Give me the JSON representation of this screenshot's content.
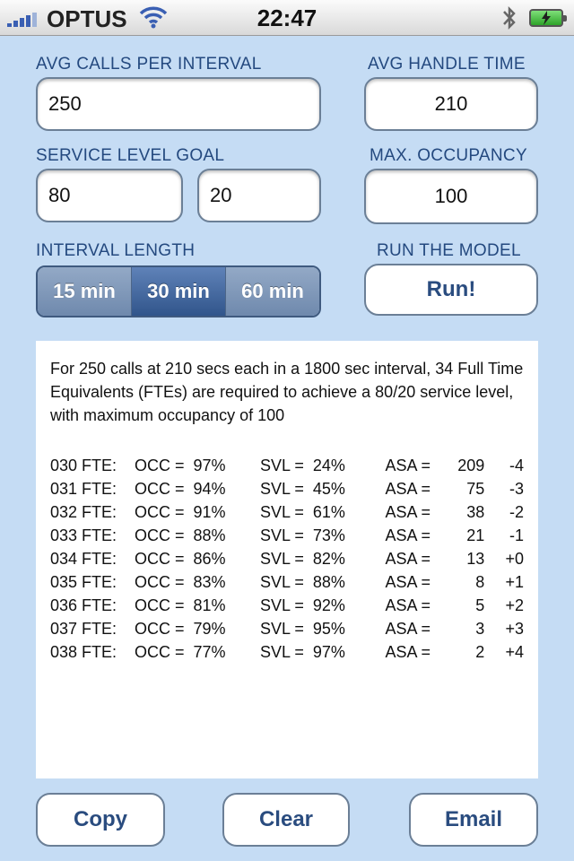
{
  "status_bar": {
    "carrier": "OPTUS",
    "time": "22:47"
  },
  "form": {
    "avg_calls_label": "AVG CALLS PER INTERVAL",
    "avg_calls_value": "250",
    "avg_handle_label": "AVG HANDLE TIME",
    "avg_handle_value": "210",
    "service_level_label": "SERVICE LEVEL GOAL",
    "service_level_percent": "80",
    "service_level_seconds": "20",
    "max_occupancy_label": "MAX. OCCUPANCY",
    "max_occupancy_value": "100",
    "interval_label": "INTERVAL LENGTH",
    "interval_options": [
      "15 min",
      "30 min",
      "60 min"
    ],
    "interval_selected": "30 min",
    "run_label": "RUN THE MODEL",
    "run_button": "Run!"
  },
  "results": {
    "summary": "For 250 calls at 210 secs each in a 1800 sec interval, 34 Full Time Equivalents (FTEs) are required to achieve a 80/20 service level, with maximum occupancy of 100",
    "rows": [
      {
        "fte": "030 FTE:",
        "occ": "OCC =  97%",
        "svl": "SVL =  24%",
        "asa": "ASA =",
        "asa_value": "209",
        "delta": "-4"
      },
      {
        "fte": "031 FTE:",
        "occ": "OCC =  94%",
        "svl": "SVL =  45%",
        "asa": "ASA =",
        "asa_value": "75",
        "delta": "-3"
      },
      {
        "fte": "032 FTE:",
        "occ": "OCC =  91%",
        "svl": "SVL =  61%",
        "asa": "ASA =",
        "asa_value": "38",
        "delta": "-2"
      },
      {
        "fte": "033 FTE:",
        "occ": "OCC =  88%",
        "svl": "SVL =  73%",
        "asa": "ASA =",
        "asa_value": "21",
        "delta": "-1"
      },
      {
        "fte": "034 FTE:",
        "occ": "OCC =  86%",
        "svl": "SVL =  82%",
        "asa": "ASA =",
        "asa_value": "13",
        "delta": "+0"
      },
      {
        "fte": "035 FTE:",
        "occ": "OCC =  83%",
        "svl": "SVL =  88%",
        "asa": "ASA =",
        "asa_value": "8",
        "delta": "+1"
      },
      {
        "fte": "036 FTE:",
        "occ": "OCC =  81%",
        "svl": "SVL =  92%",
        "asa": "ASA =",
        "asa_value": "5",
        "delta": "+2"
      },
      {
        "fte": "037 FTE:",
        "occ": "OCC =  79%",
        "svl": "SVL =  95%",
        "asa": "ASA =",
        "asa_value": "3",
        "delta": "+3"
      },
      {
        "fte": "038 FTE:",
        "occ": "OCC =  77%",
        "svl": "SVL =  97%",
        "asa": "ASA =",
        "asa_value": "2",
        "delta": "+4"
      }
    ]
  },
  "actions": {
    "copy": "Copy",
    "clear": "Clear",
    "email": "Email"
  }
}
